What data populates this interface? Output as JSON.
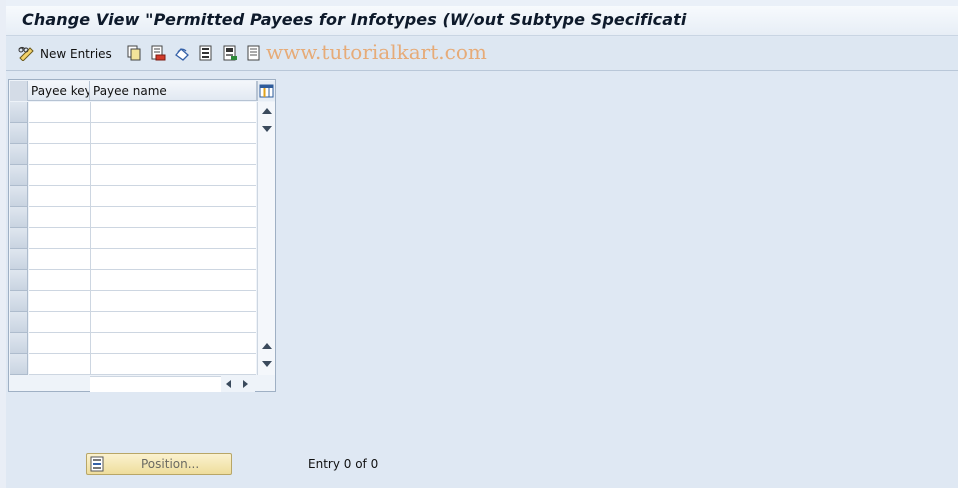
{
  "window": {
    "title": "Change View \"Permitted Payees for Infotypes (W/out Subtype Specificati"
  },
  "toolbar": {
    "new_entries_label": "New Entries",
    "icons": [
      "edit-glasses-icon",
      "copy-icon",
      "delete-icon",
      "undo-icon",
      "select-all-icon",
      "select-block-icon",
      "deselect-all-icon"
    ]
  },
  "watermark": "www.tutorialkart.com",
  "table": {
    "columns": [
      "Payee key",
      "Payee name"
    ],
    "rows": 13
  },
  "footer": {
    "position_label": "Position...",
    "entry_text": "Entry 0 of 0"
  },
  "colors": {
    "background": "#dfe8f3",
    "position_button": "#f4e7b4",
    "watermark": "#e7a56b"
  }
}
